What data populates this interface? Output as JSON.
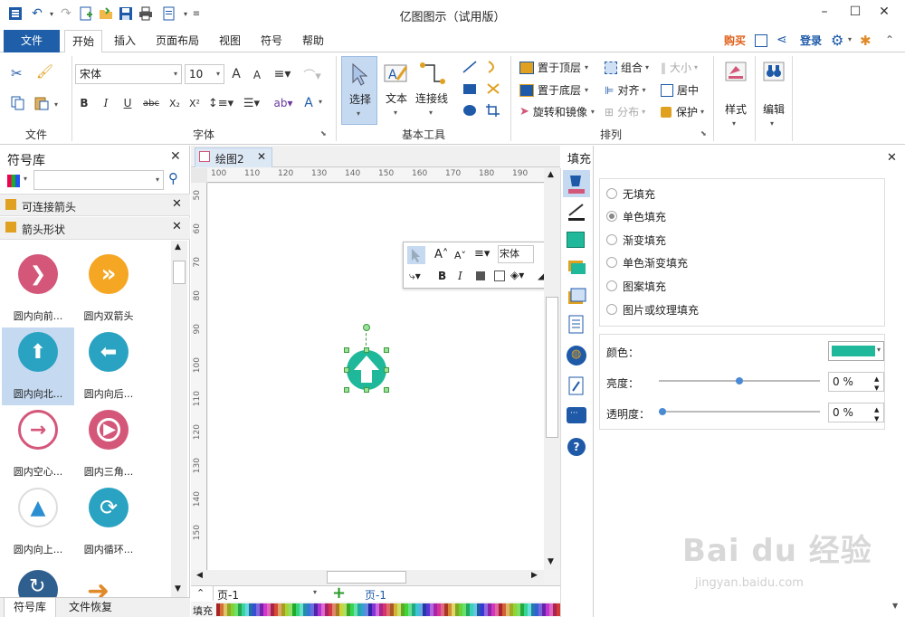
{
  "window": {
    "title": "亿图图示（试用版）",
    "controls": {
      "minimize": "–",
      "maximize": "☐",
      "close": "✕"
    }
  },
  "quick_access": [
    "app-menu-icon",
    "undo-icon",
    "redo-icon",
    "new-icon",
    "open-icon",
    "save-icon",
    "print-icon",
    "export-icon",
    "more-icon"
  ],
  "tabs": [
    "文件",
    "开始",
    "插入",
    "页面布局",
    "视图",
    "符号",
    "帮助"
  ],
  "active_tab": "开始",
  "top_right": {
    "buy": "购买",
    "login": "登录"
  },
  "ribbon": {
    "file_group": {
      "label": "文件"
    },
    "font_group": {
      "label": "字体",
      "font_name": "宋体",
      "font_size": "10",
      "buttons": {
        "bold": "B",
        "italic": "I",
        "underline": "U",
        "strike": "abc",
        "sub": "X₂",
        "sup": "X²",
        "grow": "A",
        "shrink": "A",
        "text_color": "A"
      }
    },
    "tools_group": {
      "label": "基本工具",
      "select": "选择",
      "text": "文本",
      "connector": "连接线"
    },
    "arrange_group": {
      "label": "排列",
      "bring_front": "置于顶层",
      "send_back": "置于底层",
      "rotate": "旋转和镜像",
      "group": "组合",
      "align": "对齐",
      "distribute": "分布",
      "size": "大小",
      "center": "居中",
      "protect": "保护"
    },
    "style_group": {
      "label": "样式"
    },
    "edit_group": {
      "label": "编辑"
    }
  },
  "left_panel": {
    "title": "符号库",
    "search_placeholder": "",
    "libraries": [
      "可连接箭头",
      "箭头形状"
    ],
    "items": [
      {
        "label": "圆内向前...",
        "color": "#d4577a",
        "glyph": "❯"
      },
      {
        "label": "圆内双箭头",
        "color": "#f5a623",
        "glyph": "»"
      },
      {
        "label": "圆内向北...",
        "color": "#2aa3c2",
        "glyph": "⬆"
      },
      {
        "label": "圆内向后...",
        "color": "#2aa3c2",
        "glyph": "⬅"
      },
      {
        "label": "圆内空心...",
        "color": "#d4577a",
        "glyph": "→"
      },
      {
        "label": "圆内三角...",
        "color": "#d4577a",
        "glyph": "▶"
      },
      {
        "label": "圆内向上...",
        "color": "#2aa3c2",
        "glyph": "▲"
      },
      {
        "label": "圆内循环...",
        "color": "#2aa3c2",
        "glyph": "⟳"
      }
    ],
    "bottom_tabs": [
      "符号库",
      "文件恢复"
    ]
  },
  "document": {
    "tab_name": "绘图2",
    "ruler_h": [
      "100",
      "110",
      "120",
      "130",
      "140",
      "150",
      "160",
      "170",
      "180",
      "190"
    ],
    "ruler_v": [
      "50",
      "60",
      "70",
      "80",
      "90",
      "100",
      "110",
      "120",
      "130",
      "140",
      "150"
    ],
    "page_label": "页-1",
    "page_tab": "页-1",
    "fill_label": "填充",
    "floating_font": "宋体",
    "shape_color": "#1fb89a"
  },
  "fill_panel": {
    "title": "填充",
    "options": [
      "无填充",
      "单色填充",
      "渐变填充",
      "单色渐变填充",
      "图案填充",
      "图片或纹理填充"
    ],
    "selected_option": "单色填充",
    "color_label": "颜色：",
    "color_value": "#1fb89a",
    "brightness_label": "亮度：",
    "brightness_value": "0 %",
    "transparency_label": "透明度：",
    "transparency_value": "0 %",
    "brightness_level": 0.5,
    "transparency_level": 0.0
  },
  "watermark": {
    "text": "Bai du 经验",
    "url": "jingyan.baidu.com"
  },
  "colors": {
    "accent": "#1f5fa9",
    "selection": "#c5d9f1"
  }
}
